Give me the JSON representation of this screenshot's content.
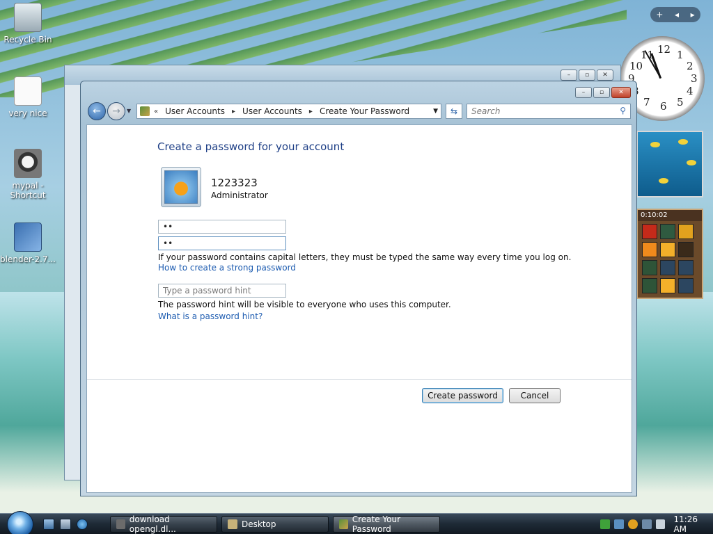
{
  "desktop": {
    "icons": [
      {
        "label": "Recycle Bin"
      },
      {
        "label": "very nice"
      },
      {
        "label": "mypal - Shortcut"
      },
      {
        "label": "blender-2.7..."
      }
    ],
    "gadgets": {
      "clock_numbers": [
        "12",
        "1",
        "2",
        "3",
        "4",
        "5",
        "6",
        "7",
        "8",
        "9",
        "10",
        "11"
      ],
      "puzzle_timer": "0:10:02",
      "top_controls": [
        "+",
        "◂",
        "▸"
      ]
    }
  },
  "window": {
    "address": {
      "prefix": "«",
      "crumbs": [
        "User Accounts",
        "User Accounts",
        "Create Your Password"
      ]
    },
    "search_placeholder": "Search",
    "heading": "Create a password for your account",
    "user": {
      "name": "1223323",
      "role": "Administrator"
    },
    "password_value": "••",
    "confirm_value": "••",
    "capital_note": "If your password contains capital letters, they must be typed the same way every time you log on.",
    "strong_link": "How to create a strong password",
    "hint_placeholder": "Type a password hint",
    "hint_note": "The password hint will be visible to everyone who uses this computer.",
    "hint_link": "What is a password hint?",
    "buttons": {
      "create": "Create password",
      "cancel": "Cancel"
    }
  },
  "taskbar": {
    "tasks": [
      {
        "label": "download opengl.dl..."
      },
      {
        "label": "Desktop"
      },
      {
        "label": "Create Your Password"
      }
    ],
    "time": "11:26 AM"
  },
  "colors": {
    "heading": "#1e3f86",
    "link": "#1c5bb0",
    "taskbar": "#1e2a36"
  }
}
